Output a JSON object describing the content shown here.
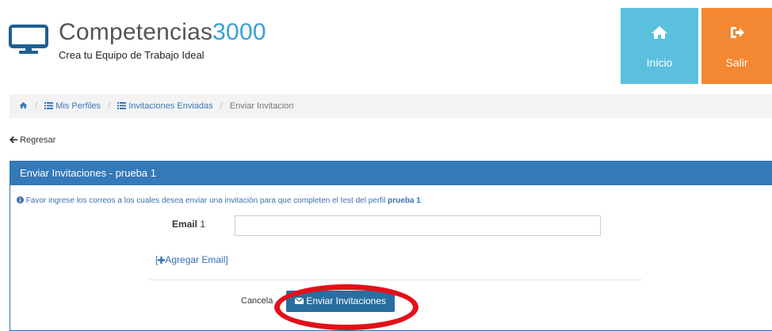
{
  "header": {
    "brand_name": "Competencias",
    "brand_number": "3000",
    "tagline": "Crea tu Equipo de Trabajo Ideal",
    "nav": {
      "inicio_label": "Inicio",
      "salir_label": "Salir"
    },
    "colors": {
      "inicio": "#5bc0de",
      "salir": "#f48731",
      "brand_accent": "#3a9fd6"
    }
  },
  "breadcrumb": {
    "items": [
      "Mis Perfiles",
      "Invitaciones Enviadas",
      "Enviar Invitacion"
    ],
    "separator": "/"
  },
  "back_link": "Regresar",
  "panel": {
    "title": "Enviar Invitaciones - prueba 1",
    "info_text": "Favor ingrese los correos a los cuales desea enviar una invitación para que completen el test del perfil ",
    "info_profile": "prueba 1",
    "email_label": "Email",
    "email_index": "1",
    "email_value": "",
    "add_email_link_open": "[",
    "add_email_link_text": "Agregar Email]",
    "cancel_label": "Cancela",
    "send_label": "Enviar Invitaciones",
    "colors": {
      "header": "#3479b8",
      "send_button": "#286e9f",
      "highlight": "#e3101b"
    }
  }
}
